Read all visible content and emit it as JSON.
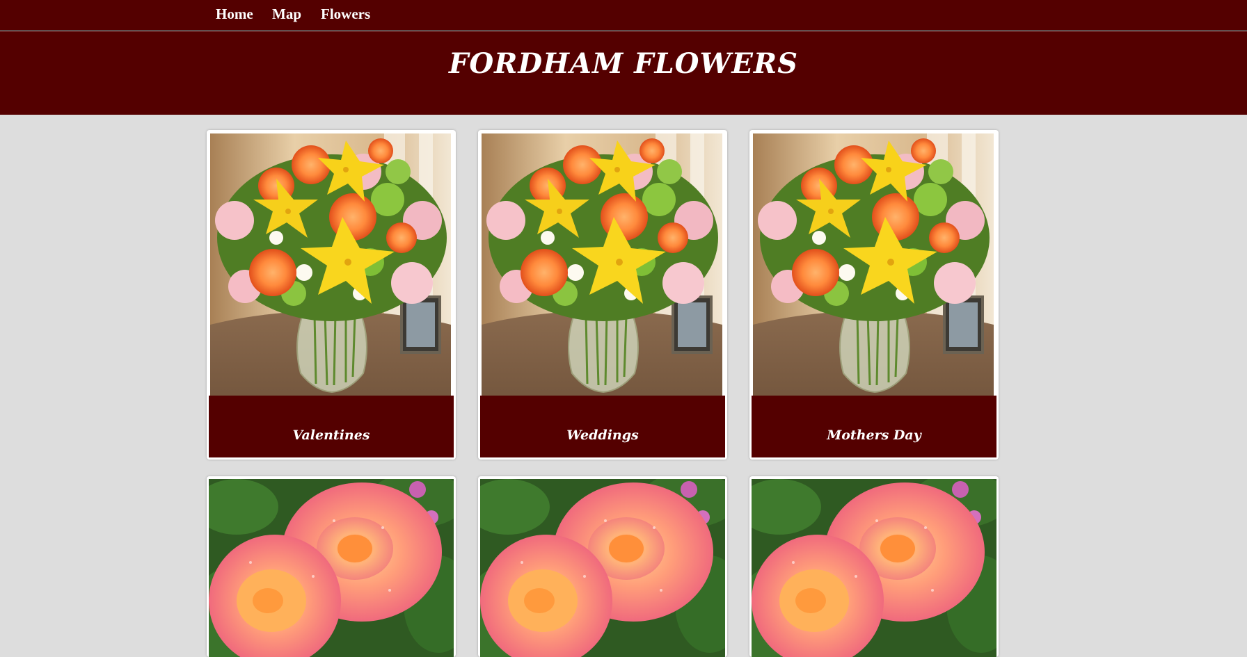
{
  "nav": {
    "items": [
      {
        "label": "Home"
      },
      {
        "label": "Map"
      },
      {
        "label": "Flowers"
      }
    ]
  },
  "header": {
    "title": "FORDHAM FLOWERS"
  },
  "cards": [
    {
      "label": "Valentines",
      "image": "mixed-bouquet-vase-image"
    },
    {
      "label": "Weddings",
      "image": "mixed-bouquet-vase-image"
    },
    {
      "label": "Mothers Day",
      "image": "mixed-bouquet-vase-image"
    },
    {
      "label": "",
      "image": "peach-roses-image"
    },
    {
      "label": "",
      "image": "peach-roses-image"
    },
    {
      "label": "",
      "image": "peach-roses-image"
    }
  ],
  "colors": {
    "brand": "#540000",
    "page_background": "#dddddd",
    "card_background": "#ffffff",
    "text_on_brand": "#ffffff"
  }
}
